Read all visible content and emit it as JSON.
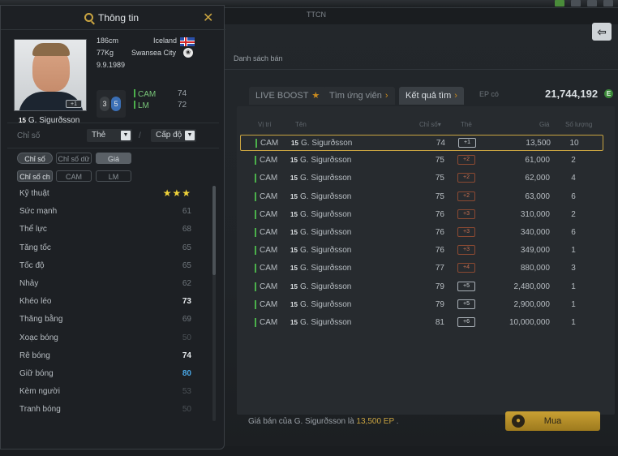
{
  "top": {
    "ttcn": "TTCN"
  },
  "main": {
    "danh_sach_ban": "Danh sách bán",
    "tabs": [
      {
        "label": "LIVE BOOST",
        "icon": "star-icon"
      },
      {
        "label": "Tìm ứng viên",
        "icon": "chevron-right-icon"
      },
      {
        "label": "Kết quả tìm",
        "icon": "chevron-right-icon"
      }
    ],
    "ep_label": "EP có",
    "ep_value": "21,744,192",
    "ep_coin": "E",
    "headers": {
      "pos": "Vị trí",
      "name": "Tên",
      "ovr": "Chỉ số",
      "card": "Thẻ",
      "price": "Giá",
      "qty": "Số lượng"
    },
    "rows": [
      {
        "pos": "CAM",
        "num": "15",
        "name": "G. Sigurðsson",
        "ovr": "74",
        "card": "+1",
        "price": "13,500",
        "qty": "10"
      },
      {
        "pos": "CAM",
        "num": "15",
        "name": "G. Sigurðsson",
        "ovr": "75",
        "card": "+2",
        "price": "61,000",
        "qty": "2"
      },
      {
        "pos": "CAM",
        "num": "15",
        "name": "G. Sigurðsson",
        "ovr": "75",
        "card": "+2",
        "price": "62,000",
        "qty": "4"
      },
      {
        "pos": "CAM",
        "num": "15",
        "name": "G. Sigurðsson",
        "ovr": "75",
        "card": "+2",
        "price": "63,000",
        "qty": "6"
      },
      {
        "pos": "CAM",
        "num": "15",
        "name": "G. Sigurðsson",
        "ovr": "76",
        "card": "+3",
        "price": "310,000",
        "qty": "2"
      },
      {
        "pos": "CAM",
        "num": "15",
        "name": "G. Sigurðsson",
        "ovr": "76",
        "card": "+3",
        "price": "340,000",
        "qty": "6"
      },
      {
        "pos": "CAM",
        "num": "15",
        "name": "G. Sigurðsson",
        "ovr": "76",
        "card": "+3",
        "price": "349,000",
        "qty": "1"
      },
      {
        "pos": "CAM",
        "num": "15",
        "name": "G. Sigurðsson",
        "ovr": "77",
        "card": "+4",
        "price": "880,000",
        "qty": "3"
      },
      {
        "pos": "CAM",
        "num": "15",
        "name": "G. Sigurðsson",
        "ovr": "79",
        "card": "+5",
        "price": "2,480,000",
        "qty": "1"
      },
      {
        "pos": "CAM",
        "num": "15",
        "name": "G. Sigurðsson",
        "ovr": "79",
        "card": "+5",
        "price": "2,900,000",
        "qty": "1"
      },
      {
        "pos": "CAM",
        "num": "15",
        "name": "G. Sigurðsson",
        "ovr": "81",
        "card": "+6",
        "price": "10,000,000",
        "qty": "1"
      }
    ],
    "bottom": {
      "prefix": "Giá bán của G. Sigurðsson là",
      "price": "13,500 EP",
      "suffix": "."
    },
    "buy_label": "Mua"
  },
  "info": {
    "title": "Thông tin",
    "player": {
      "number": "15",
      "name": "G. Sigurðsson",
      "card_badge": "+1",
      "height": "186cm",
      "weight": "77Kg",
      "dob": "9.9.1989",
      "country": "Iceland",
      "club": "Swansea City",
      "weak_foot_left": "3",
      "weak_foot_right": "5",
      "positions": [
        {
          "pos": "CAM",
          "value": "74"
        },
        {
          "pos": "LM",
          "value": "72"
        }
      ]
    },
    "filters": {
      "label": "Chỉ số",
      "select1": "Thẻ",
      "select2": "Cấp độ"
    },
    "pills_row1": [
      "Chỉ số",
      "Chỉ số dữ",
      "Giá"
    ],
    "pills_row2": [
      "Chỉ số ch",
      "CAM",
      "LM"
    ],
    "stats": [
      {
        "k": "Kỹ thuật",
        "v": "★★★",
        "style": "stars"
      },
      {
        "k": "Sức mạnh",
        "v": "61",
        "style": ""
      },
      {
        "k": "Thể lực",
        "v": "68",
        "style": ""
      },
      {
        "k": "Tăng tốc",
        "v": "65",
        "style": ""
      },
      {
        "k": "Tốc độ",
        "v": "65",
        "style": ""
      },
      {
        "k": "Nhảy",
        "v": "62",
        "style": ""
      },
      {
        "k": "Khéo léo",
        "v": "73",
        "style": "hi"
      },
      {
        "k": "Thăng bằng",
        "v": "69",
        "style": ""
      },
      {
        "k": "Xoạc bóng",
        "v": "50",
        "style": "dim"
      },
      {
        "k": "Rê bóng",
        "v": "74",
        "style": "hi"
      },
      {
        "k": "Giữ bóng",
        "v": "80",
        "style": "blue"
      },
      {
        "k": "Kèm người",
        "v": "53",
        "style": "dim"
      },
      {
        "k": "Tranh bóng",
        "v": "50",
        "style": "dim"
      }
    ]
  }
}
